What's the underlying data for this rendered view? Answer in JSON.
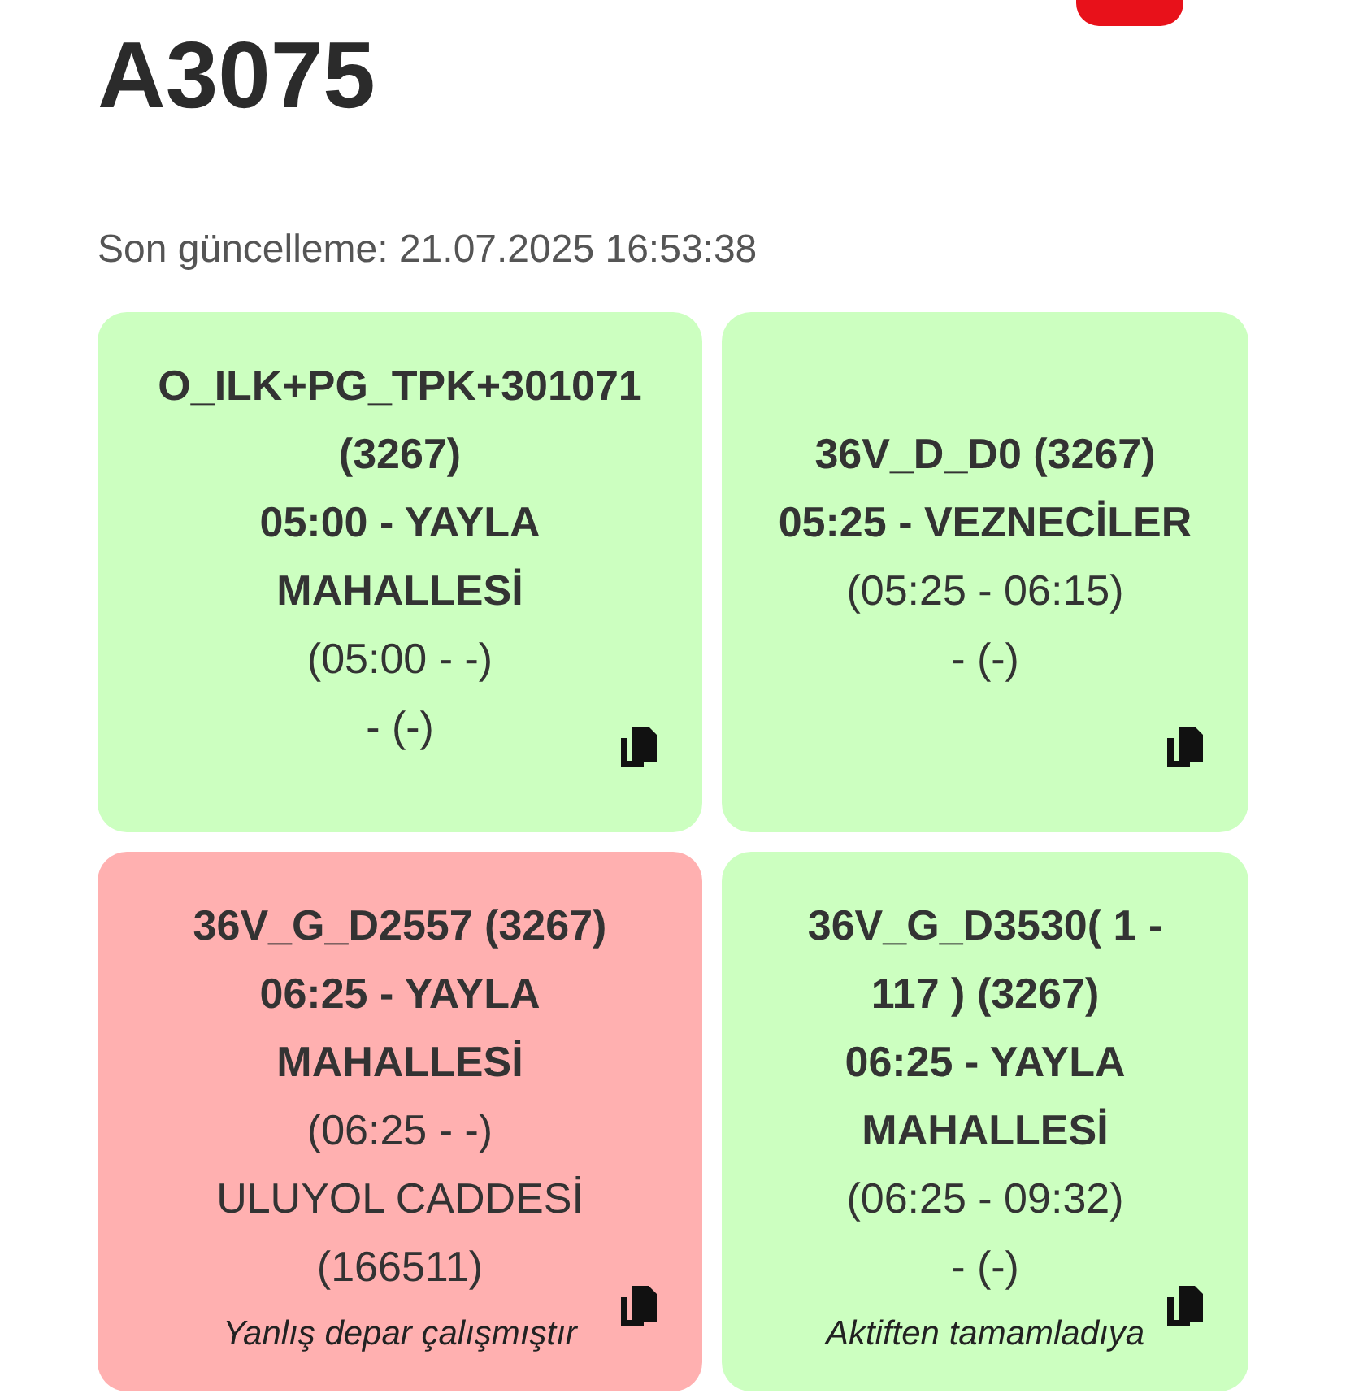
{
  "header": {
    "title": "A3075",
    "last_updated": "Son güncelleme: 21.07.2025 16:53:38"
  },
  "cards": [
    {
      "color": "#ccffc0",
      "route": "O_ILK+PG_TPK+301071 (3267)",
      "departure": "05:00 - YAYLA MAHALLESİ",
      "times": "(05:00 - -)",
      "stop": "- (-)"
    },
    {
      "color": "#ccffc0",
      "route": "36V_D_D0 (3267)",
      "departure": "05:25 - VEZNECİLER",
      "times": "(05:25 - 06:15)",
      "stop": "- (-)"
    },
    {
      "color": "#ffb0b0",
      "route": "36V_G_D2557 (3267)",
      "departure": "06:25 - YAYLA MAHALLESİ",
      "times": "(06:25 - -)",
      "stop": "ULUYOL CADDESİ (166511)",
      "note": "Yanlış depar çalışmıştır"
    },
    {
      "color": "#ccffc0",
      "route": "36V_G_D3530( 1 - 117 ) (3267)",
      "departure": "06:25 - YAYLA MAHALLESİ",
      "times": "(06:25 - 09:32)",
      "stop": "- (-)",
      "note": "Aktiften tamamladıya"
    }
  ]
}
